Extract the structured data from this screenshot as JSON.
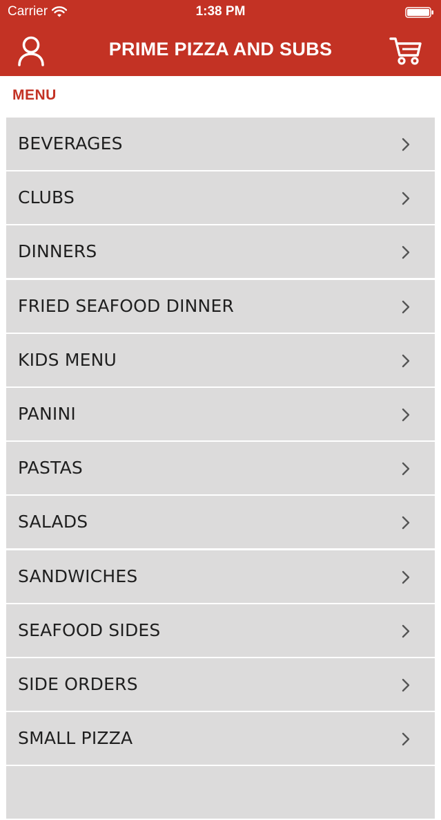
{
  "status_bar": {
    "carrier": "Carrier",
    "time": "1:38 PM"
  },
  "navbar": {
    "title": "PRIME PIZZA AND SUBS",
    "left_icon": "user-icon",
    "right_icon": "cart-icon"
  },
  "section": {
    "label": "MENU"
  },
  "menu": {
    "items": [
      {
        "label": "BEVERAGES"
      },
      {
        "label": "CLUBS"
      },
      {
        "label": "DINNERS"
      },
      {
        "label": "FRIED SEAFOOD DINNER"
      },
      {
        "label": "KIDS MENU"
      },
      {
        "label": "PANINI"
      },
      {
        "label": "PASTAS"
      },
      {
        "label": "SALADS"
      },
      {
        "label": "SANDWICHES"
      },
      {
        "label": "SEAFOOD SIDES"
      },
      {
        "label": "SIDE ORDERS"
      },
      {
        "label": "SMALL PIZZA"
      },
      {
        "label": ""
      }
    ]
  },
  "colors": {
    "brand": "#c33224",
    "row_background": "#dcdbdb",
    "row_text": "#1f1f1f"
  }
}
